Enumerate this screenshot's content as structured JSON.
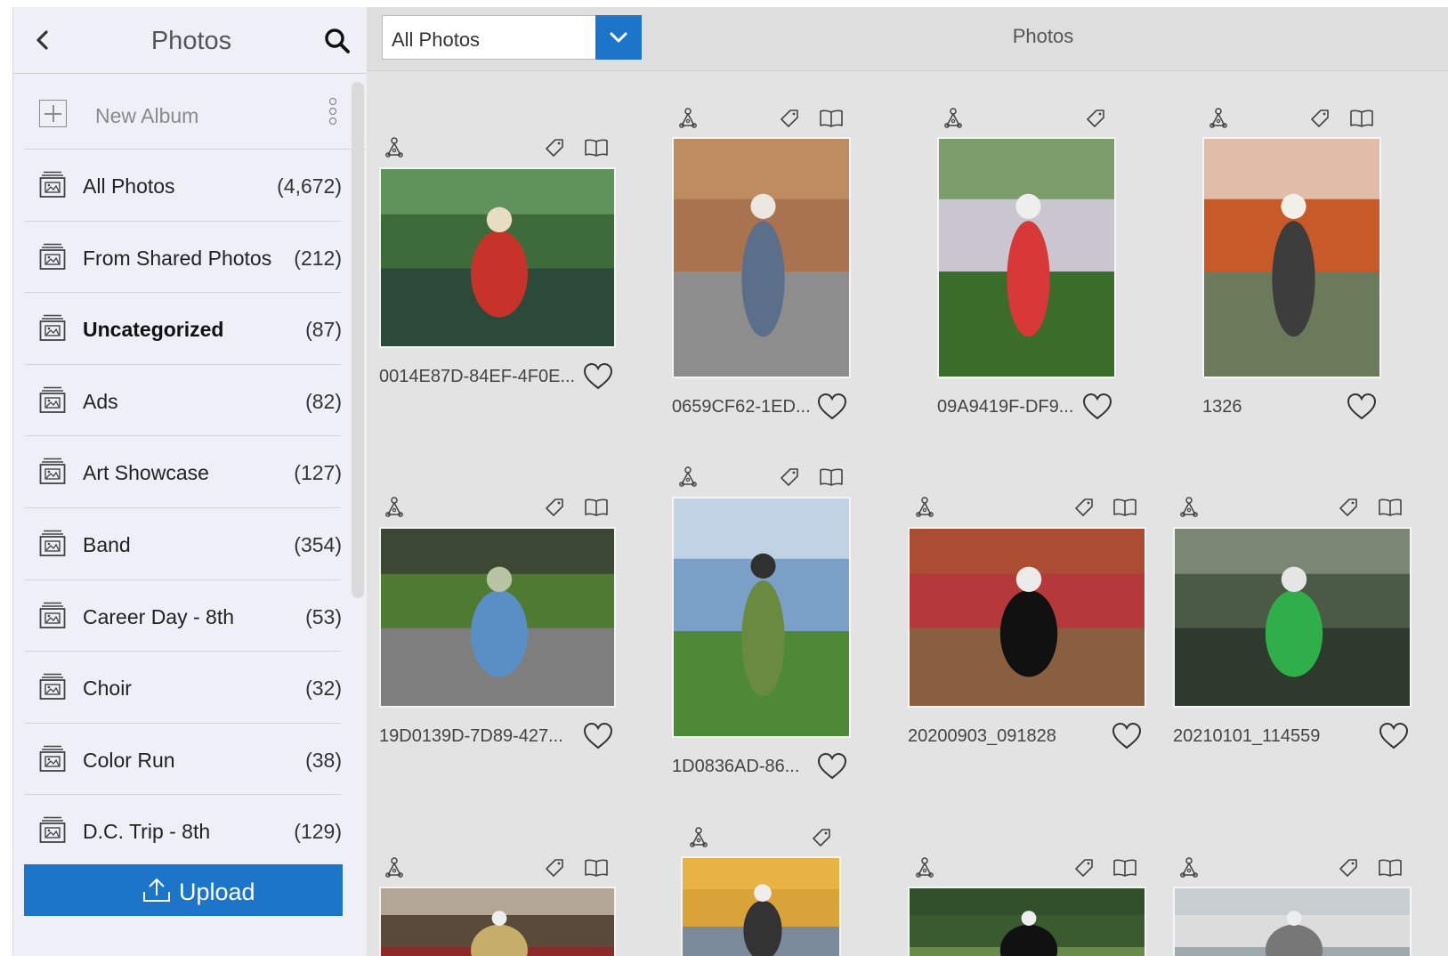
{
  "sidebar": {
    "back_icon": "chevron-left-icon",
    "title": "Photos",
    "search_icon": "search-icon",
    "new_album": {
      "icon": "plus-square-icon",
      "label": "New Album",
      "menu_icon": "kebab-menu-icon"
    },
    "albums": [
      {
        "name": "All Photos",
        "count": "(4,672)"
      },
      {
        "name": "From Shared Photos",
        "count": "(212)"
      },
      {
        "name": "Uncategorized",
        "count": "(87)",
        "selected": true
      },
      {
        "name": "Ads",
        "count": "(82)"
      },
      {
        "name": "Art Showcase",
        "count": "(127)"
      },
      {
        "name": "Band",
        "count": "(354)"
      },
      {
        "name": "Career Day - 8th",
        "count": "(53)"
      },
      {
        "name": "Choir",
        "count": "(32)"
      },
      {
        "name": "Color Run",
        "count": "(38)"
      },
      {
        "name": "D.C. Trip - 8th",
        "count": "(129)"
      }
    ],
    "upload": {
      "icon": "upload-icon",
      "label": "Upload"
    }
  },
  "topbar": {
    "filter_value": "All Photos",
    "dropdown_icon": "chevron-down-icon",
    "title": "Photos"
  },
  "photos": [
    {
      "caption": "0014E87D-84EF-4F0E...",
      "icons": [
        "people-tag-icon",
        "tag-icon",
        "book-icon",
        "heart-icon"
      ]
    },
    {
      "caption": "0659CF62-1ED...",
      "icons": [
        "people-tag-icon",
        "tag-icon",
        "book-icon",
        "heart-icon"
      ]
    },
    {
      "caption": "09A9419F-DF9...",
      "icons": [
        "people-tag-icon",
        "tag-icon",
        "heart-icon"
      ]
    },
    {
      "caption": "1326",
      "icons": [
        "people-tag-icon",
        "tag-icon",
        "book-icon",
        "heart-icon"
      ]
    },
    {
      "caption": "19D0139D-7D89-427...",
      "icons": [
        "people-tag-icon",
        "tag-icon",
        "book-icon",
        "heart-icon"
      ]
    },
    {
      "caption": "1D0836AD-86...",
      "icons": [
        "people-tag-icon",
        "tag-icon",
        "book-icon",
        "heart-icon"
      ]
    },
    {
      "caption": "20200903_091828",
      "icons": [
        "people-tag-icon",
        "tag-icon",
        "book-icon",
        "heart-icon"
      ]
    },
    {
      "caption": "20210101_114559",
      "icons": [
        "people-tag-icon",
        "tag-icon",
        "book-icon",
        "heart-icon"
      ]
    },
    {
      "caption": "",
      "icons": [
        "people-tag-icon",
        "tag-icon",
        "book-icon"
      ]
    },
    {
      "caption": "",
      "icons": [
        "people-tag-icon",
        "tag-icon"
      ]
    },
    {
      "caption": "",
      "icons": [
        "people-tag-icon",
        "tag-icon",
        "book-icon"
      ]
    },
    {
      "caption": "",
      "icons": [
        "people-tag-icon",
        "tag-icon",
        "book-icon"
      ]
    }
  ],
  "colors": {
    "accent": "#1c75c8",
    "sidebar_bg": "#eff0f7",
    "main_bg": "#e3e3e3"
  }
}
